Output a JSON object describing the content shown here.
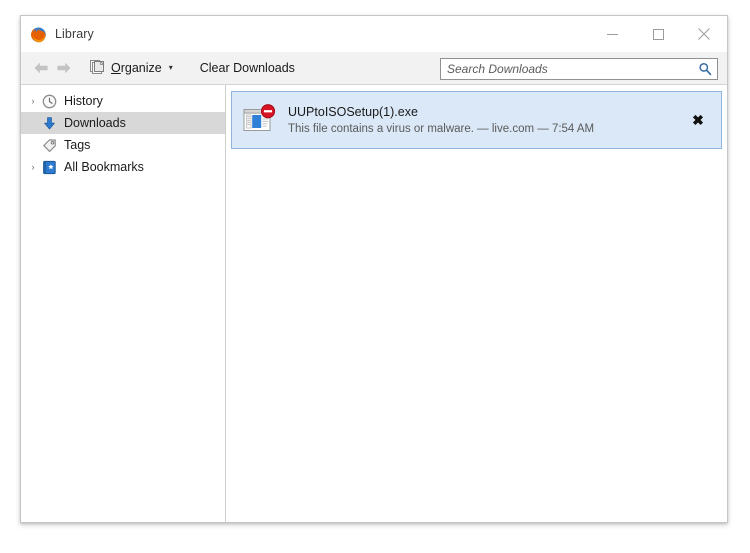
{
  "window": {
    "title": "Library",
    "app_icon": "firefox-logo-icon",
    "controls": {
      "minimize": "minimize-icon",
      "maximize": "maximize-icon",
      "close": "close-icon"
    }
  },
  "toolbar": {
    "back": "back-arrow-icon",
    "forward": "forward-arrow-icon",
    "organize_label_pre": "",
    "organize_label_accesskey": "O",
    "organize_label_rest": "rganize",
    "organize_caret": "▾",
    "clear_downloads_label": "Clear Downloads",
    "search": {
      "placeholder": "Search Downloads",
      "value": "",
      "icon": "search-icon"
    }
  },
  "sidebar": {
    "items": [
      {
        "label": "History",
        "icon": "clock-icon",
        "twisty": "›",
        "has_twisty": true,
        "selected": false
      },
      {
        "label": "Downloads",
        "icon": "download-arrow-icon",
        "twisty": "",
        "has_twisty": false,
        "selected": true
      },
      {
        "label": "Tags",
        "icon": "tag-icon",
        "twisty": "",
        "has_twisty": false,
        "selected": false
      },
      {
        "label": "All Bookmarks",
        "icon": "bookmarks-book-icon",
        "twisty": "›",
        "has_twisty": true,
        "selected": false
      }
    ]
  },
  "downloads": {
    "items": [
      {
        "filename": "UUPtoISOSetup(1).exe",
        "status": "This file contains a virus or malware. — live.com — 7:54 AM",
        "icon": "blocked-file-icon",
        "remove_label": "✖",
        "selected": true
      }
    ]
  },
  "colors": {
    "accent_blue": "#2b63a8",
    "selection_bg": "#dae8f7",
    "selection_border": "#8fb5de",
    "sidebar_selected_bg": "#d8d8d8",
    "toolbar_bg": "#f2f2f2",
    "danger_red": "#d0021b"
  }
}
